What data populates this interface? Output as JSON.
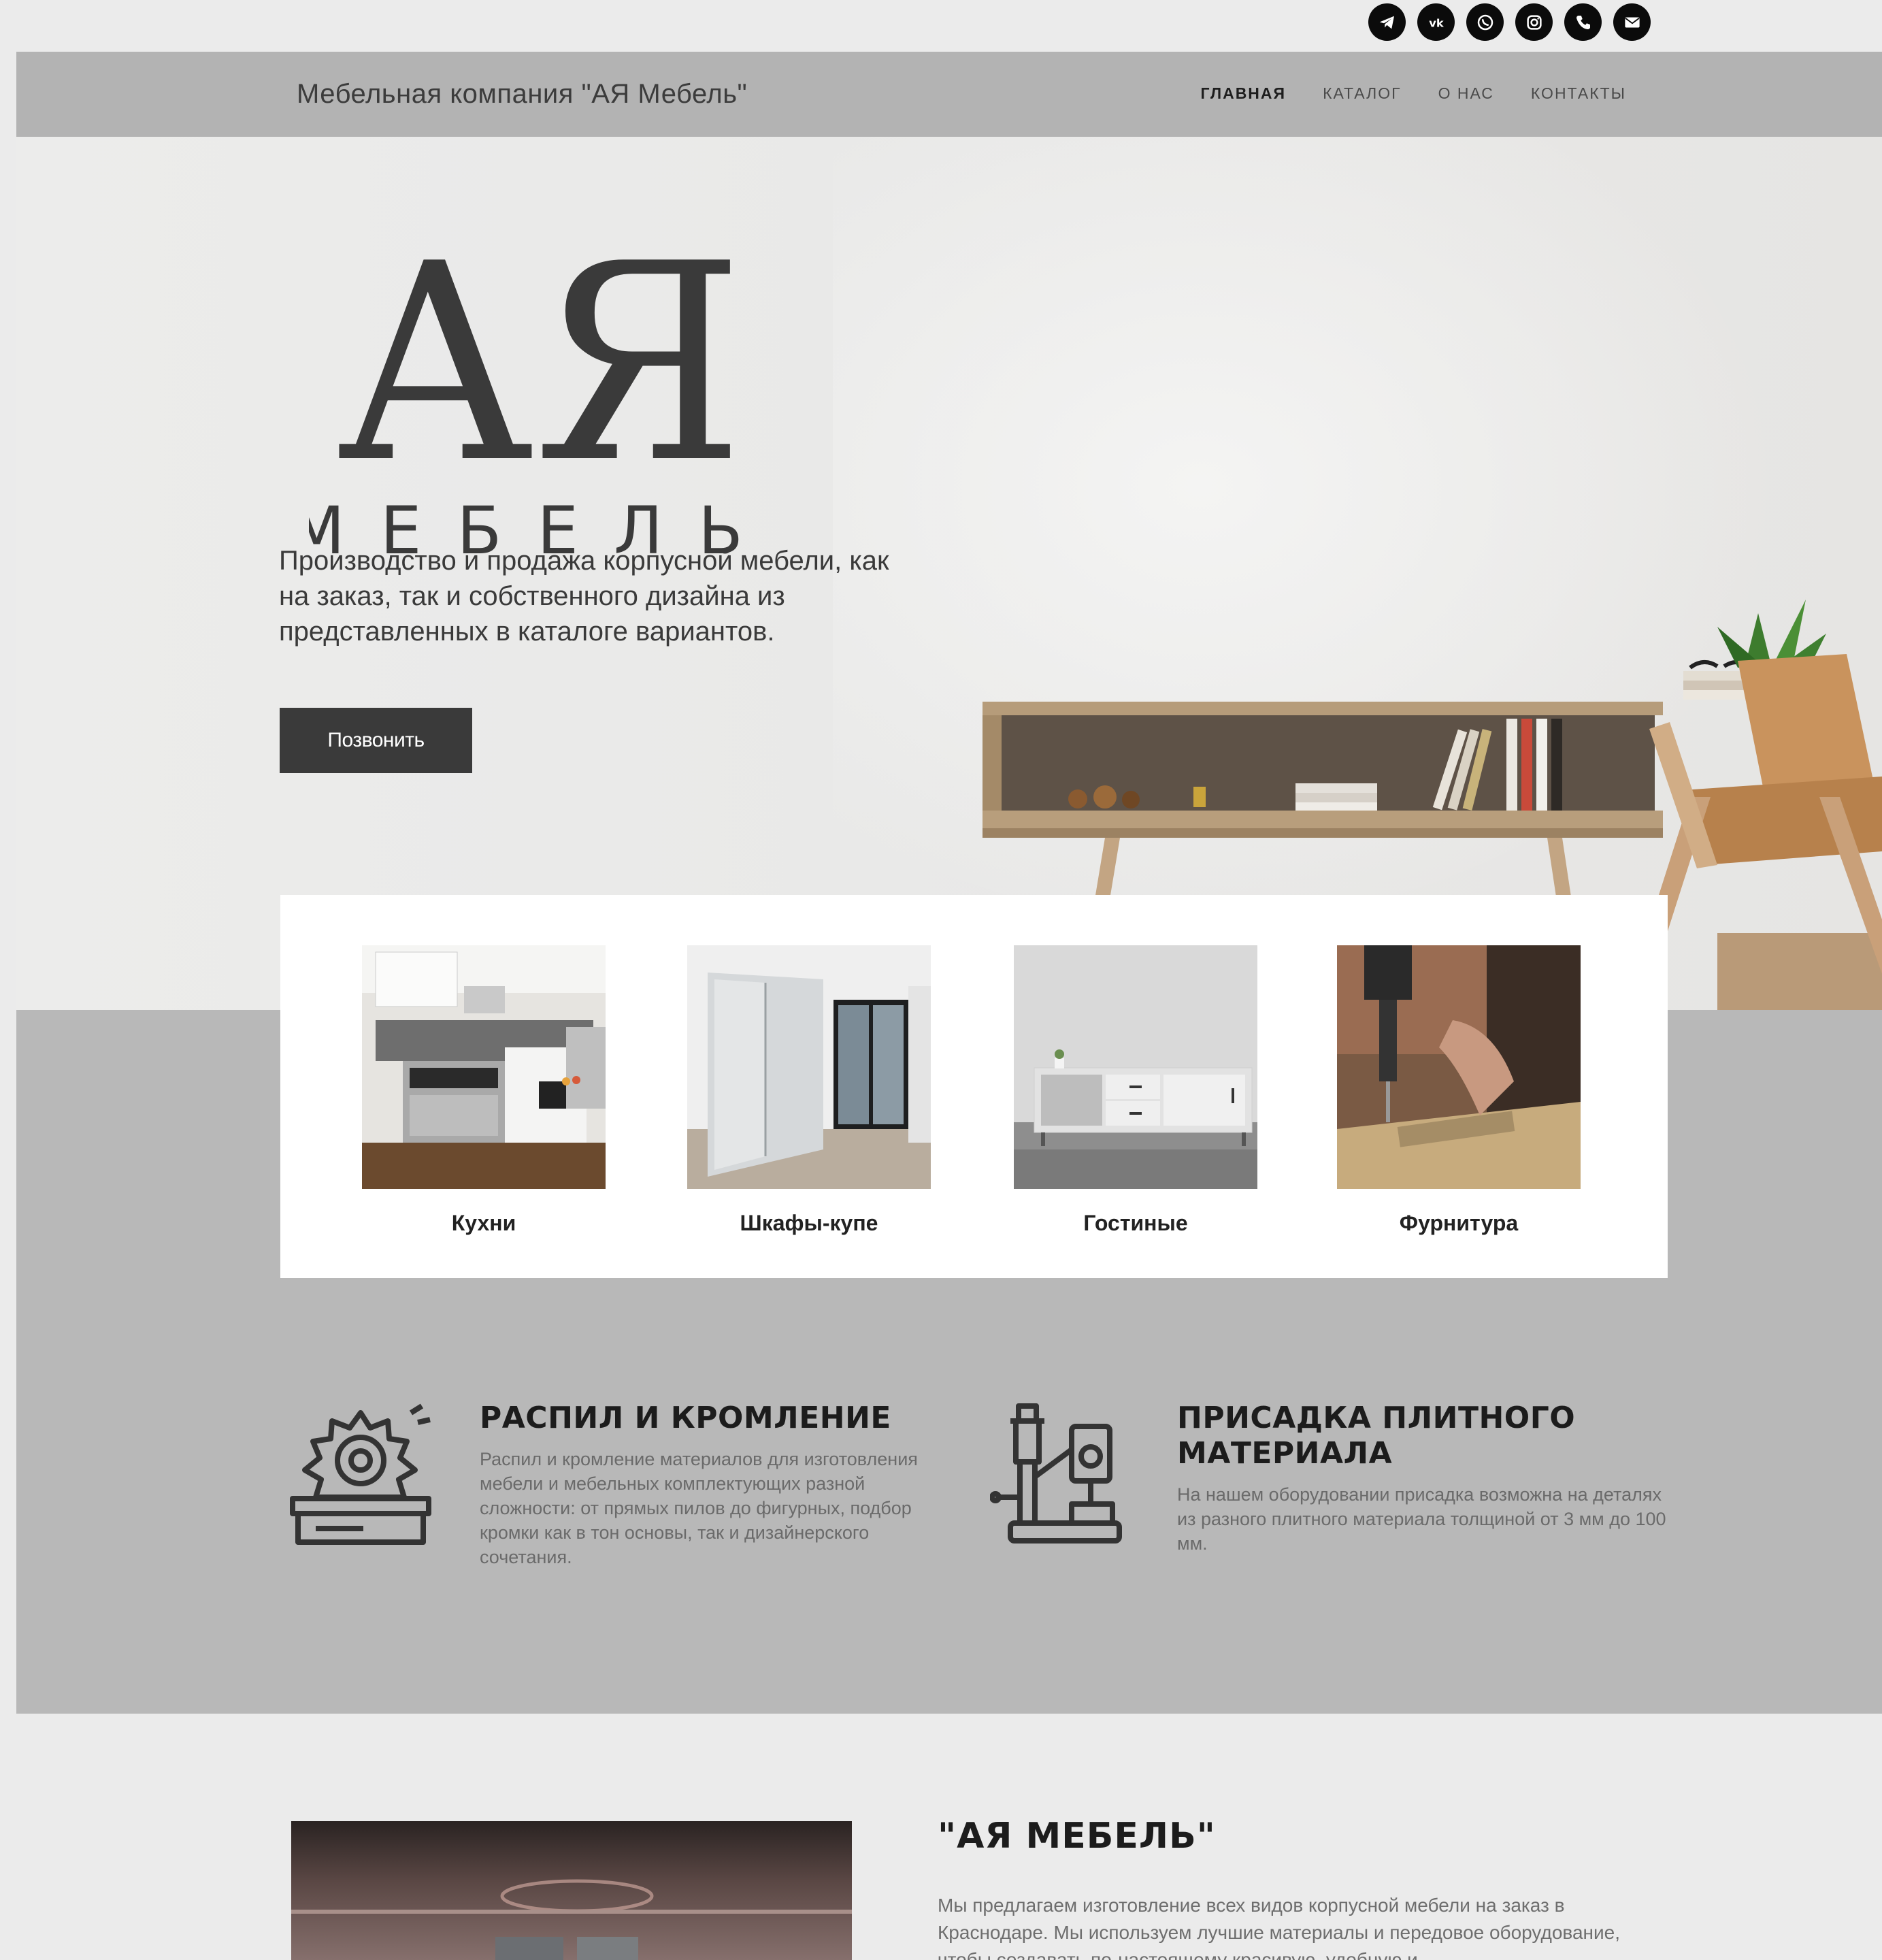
{
  "social": {
    "icons": [
      "telegram-icon",
      "vk-icon",
      "whatsapp-icon",
      "instagram-icon",
      "phone-icon",
      "mail-icon"
    ]
  },
  "header": {
    "brand": "Мебельная компания \"АЯ Мебель\"",
    "nav": [
      "ГЛАВНАЯ",
      "КАТАЛОГ",
      "О НАС",
      "КОНТАКТЫ"
    ],
    "active_index": 0
  },
  "hero": {
    "logo_letters": "АЯ",
    "logo_word": "МЕБЕЛЬ",
    "text": "Производство и продажа корпусной мебели, как на заказ, так и собственного дизайна из представленных в каталоге вариантов.",
    "button": "Позвонить"
  },
  "categories": [
    "Кухни",
    "Шкафы-купе",
    "Гостиные",
    "Фурнитура"
  ],
  "services": [
    {
      "title": "РАСПИЛ И КРОМЛЕНИЕ",
      "description": "Распил и кромление материалов для изготовления мебели и мебельных комплектующих разной сложности: от прямых пилов до фигурных, подбор кромки как в тон основы, так и дизайнерского сочетания."
    },
    {
      "title": "ПРИСАДКА ПЛИТНОГО МАТЕРИАЛА",
      "description": "На нашем оборудовании присадка возможна на деталях из разного плитного материала толщиной от 3 мм до 100 мм."
    }
  ],
  "about": {
    "title": "\"АЯ МЕБЕЛЬ\"",
    "text": "Мы предлагаем изготовление всех видов корпусной мебели на заказ в Краснодаре. Мы используем лучшие материалы и передовое оборудование, чтобы создавать по-настоящему красивую, удобную и"
  },
  "colors": {
    "header_bg": "#b3b3b3",
    "grey_section": "#b8b8b8",
    "button_bg": "#3a3a3a",
    "page_bg": "#ebebeb"
  }
}
